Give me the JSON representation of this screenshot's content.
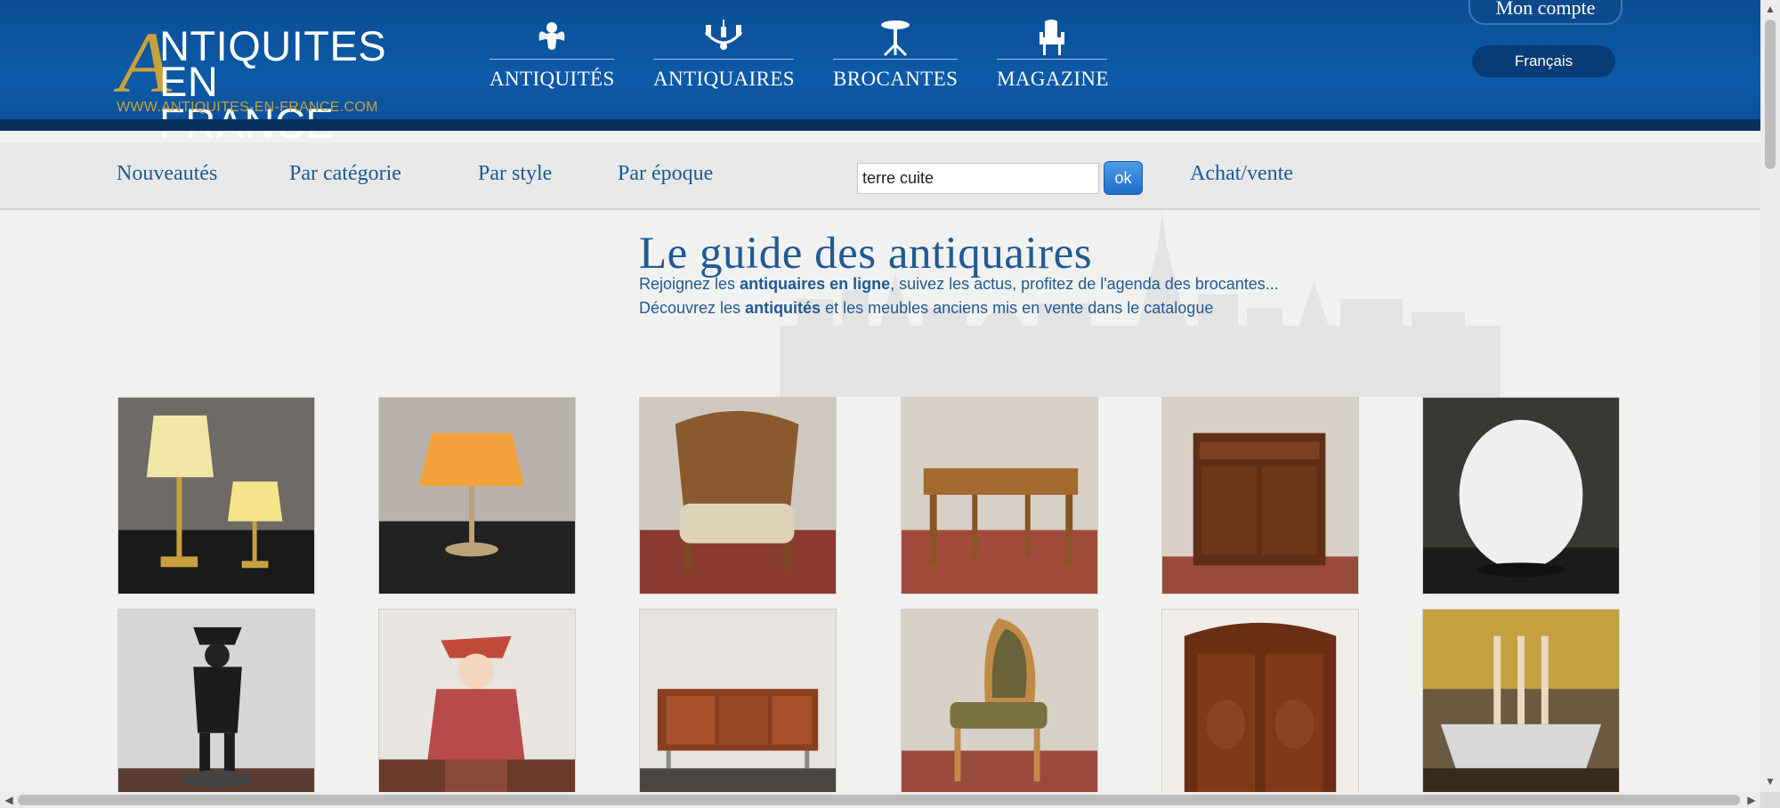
{
  "header": {
    "logo": {
      "initial": "A",
      "line1": "NTIQUITES",
      "line2": "EN FRANCE",
      "url": "WWW.ANTIQUITES-EN-FRANCE.COM"
    },
    "main_nav": [
      {
        "label": "ANTIQUITÉS",
        "icon": "cherub-icon"
      },
      {
        "label": "ANTIQUAIRES",
        "icon": "chandelier-icon"
      },
      {
        "label": "BROCANTES",
        "icon": "gueridon-table-icon"
      },
      {
        "label": "MAGAZINE",
        "icon": "armchair-icon"
      }
    ],
    "account_label": "Mon compte",
    "language_label": "Français"
  },
  "sub_nav": {
    "links": [
      "Nouveautés",
      "Par catégorie",
      "Par style",
      "Par époque"
    ],
    "search": {
      "value": "terre cuite",
      "button": "ok"
    },
    "achat_vente": "Achat/vente"
  },
  "hero": {
    "title": "Le guide des antiquaires",
    "line1": {
      "before": "Rejoignez les ",
      "bold": "antiquaires en ligne",
      "after": ", suivez les actus, profitez de l'agenda des brocantes..."
    },
    "line2": {
      "before": "Découvrez les ",
      "bold": "antiquités",
      "after": " et les meubles anciens mis en vente dans le catalogue"
    }
  },
  "products": [
    {
      "name": "pair-of-brass-lamps"
    },
    {
      "name": "orange-shade-lamp"
    },
    {
      "name": "cane-back-armchair"
    },
    {
      "name": "wooden-writing-desk"
    },
    {
      "name": "wooden-cabinet"
    },
    {
      "name": "white-egg-lamp"
    },
    {
      "name": "bronze-napoleon-statue"
    },
    {
      "name": "antique-doll-automaton"
    },
    {
      "name": "rosewood-sideboard"
    },
    {
      "name": "leather-armchair"
    },
    {
      "name": "carved-armoire"
    },
    {
      "name": "silver-candle-tray"
    }
  ],
  "colors": {
    "header_blue": "#0d5aa8",
    "gold": "#c9a13b",
    "link_blue": "#1d5a95",
    "subnav_bg": "#e8e8e8"
  }
}
